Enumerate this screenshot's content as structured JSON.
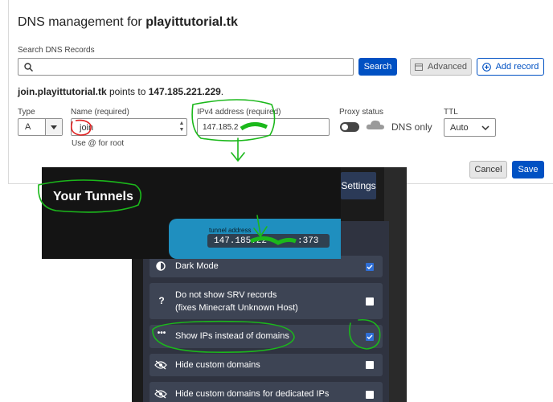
{
  "dns": {
    "title_prefix": "DNS management for ",
    "title_domain": "playittutorial.tk",
    "search_label": "Search DNS Records",
    "search_value": "",
    "search_button": "Search",
    "advanced_button": "Advanced",
    "add_record_button": "Add record",
    "points_host": "join.playittutorial.tk",
    "points_mid": " points to ",
    "points_ip": "147.185.221.229",
    "points_end": ".",
    "type_label": "Type",
    "type_value": "A",
    "name_label": "Name (required)",
    "name_value": "join",
    "name_hint": "Use @ for root",
    "ipv4_label": "IPv4 address (required)",
    "ipv4_value": "147.185.2",
    "proxy_label": "Proxy status",
    "proxy_value": "DNS only",
    "ttl_label": "TTL",
    "ttl_value": "Auto",
    "cancel_button": "Cancel",
    "save_button": "Save"
  },
  "tunnels": {
    "title": "Your Tunnels",
    "settings_button": "Settings",
    "address_label": "tunnel address",
    "address_value": "147.185.22",
    "address_port": ":373"
  },
  "settings": {
    "items": [
      {
        "label": "Dark Mode",
        "checked": true
      },
      {
        "label": "Do not show SRV records",
        "label2": "(fixes Minecraft Unknown Host)",
        "checked": false
      },
      {
        "label": "Show IPs instead of domains",
        "checked": true
      },
      {
        "label": "Hide custom domains",
        "checked": false
      },
      {
        "label": "Hide custom domains for dedicated IPs",
        "checked": false
      }
    ]
  },
  "colors": {
    "accent_blue": "#0051c3",
    "annotation_green": "#1bb81b",
    "annotation_red": "#e02020",
    "setting_row_bg": "#3d4454"
  }
}
